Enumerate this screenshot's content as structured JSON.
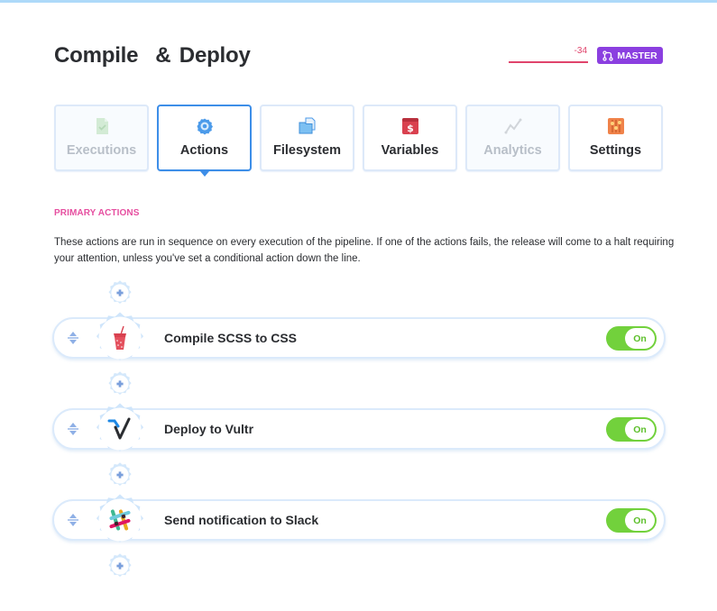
{
  "header": {
    "title": "Compile  & Deploy",
    "diff_value": "-34",
    "branch_label": "MASTER",
    "branch_icon": "git-branch-icon"
  },
  "colors": {
    "accent": "#3d8ee8",
    "branch_badge": "#8b3fe0",
    "diff_line": "#e0446c",
    "section_label": "#e64fa0",
    "toggle_on": "#72d13c"
  },
  "tabs": [
    {
      "label": "Executions",
      "icon": "document-check-icon",
      "state": "disabled"
    },
    {
      "label": "Actions",
      "icon": "gear-icon",
      "state": "active"
    },
    {
      "label": "Filesystem",
      "icon": "folder-icon",
      "state": "normal"
    },
    {
      "label": "Variables",
      "icon": "dollar-box-icon",
      "state": "normal"
    },
    {
      "label": "Analytics",
      "icon": "line-chart-icon",
      "state": "disabled"
    },
    {
      "label": "Settings",
      "icon": "sliders-icon",
      "state": "normal"
    }
  ],
  "section": {
    "label": "PRIMARY ACTIONS",
    "description": "These actions are run in sequence on every execution of the pipeline. If one of the actions fails, the release will come to a halt requiring your attention, unless you've set a conditional action down the line."
  },
  "actions": [
    {
      "label": "Compile SCSS to CSS",
      "logo": "gulp-cup-icon",
      "toggle": "On",
      "enabled": true
    },
    {
      "label": "Deploy to Vultr",
      "logo": "vultr-logo-icon",
      "toggle": "On",
      "enabled": true
    },
    {
      "label": "Send notification to Slack",
      "logo": "slack-logo-icon",
      "toggle": "On",
      "enabled": true
    }
  ]
}
